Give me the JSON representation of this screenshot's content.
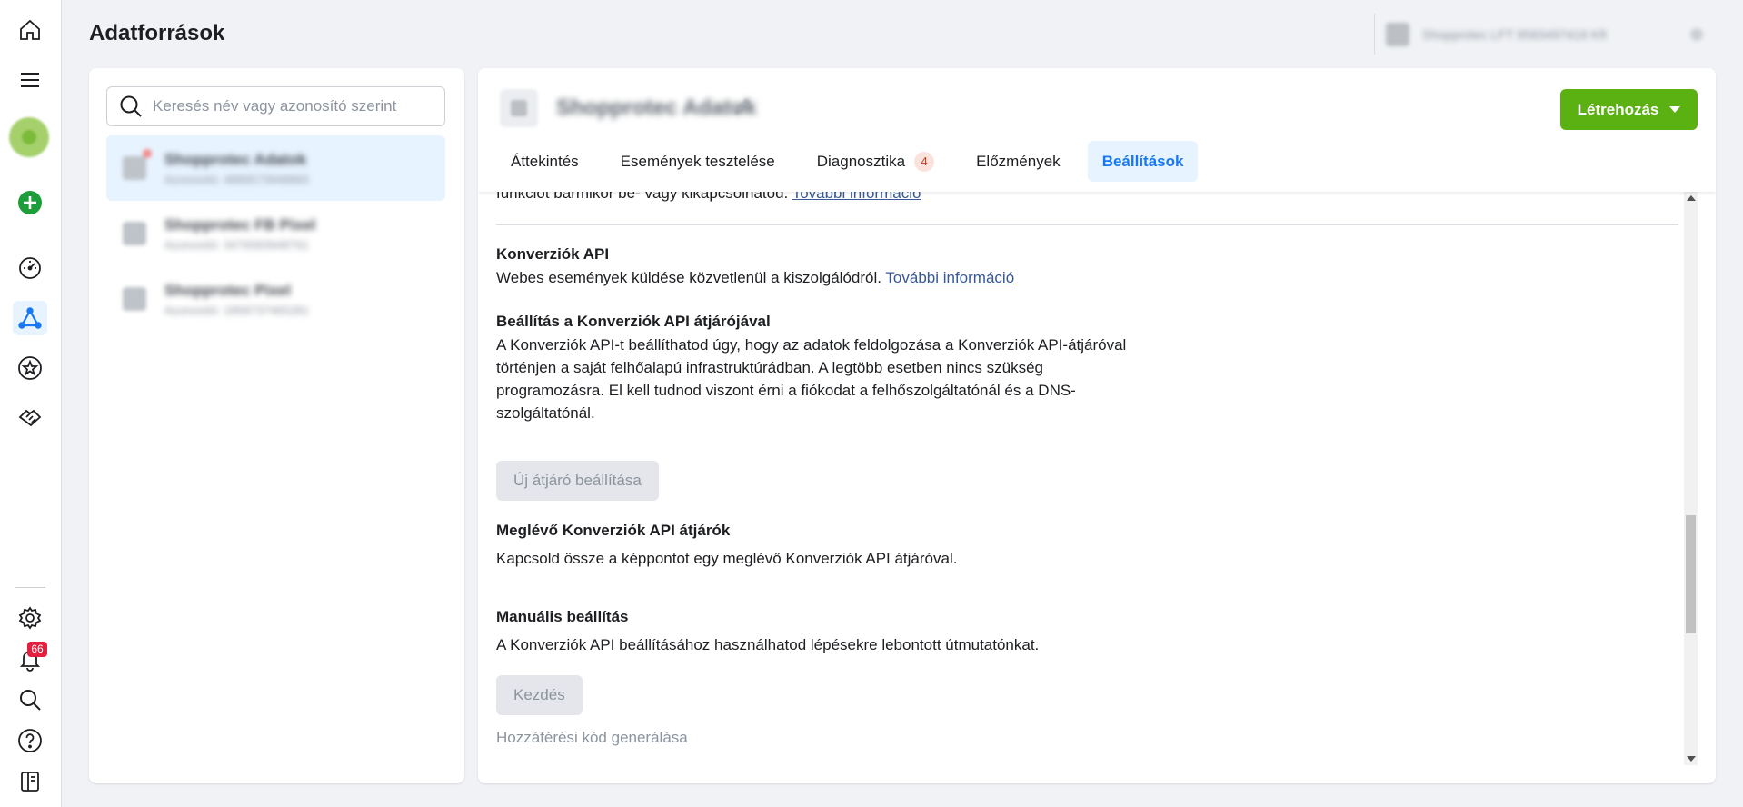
{
  "page": {
    "title": "Adatforrások"
  },
  "account": {
    "name": "Shopprotec LFT 9583497416 Kft"
  },
  "rail": {
    "notifications_count": "66"
  },
  "search": {
    "placeholder": "Keresés név vagy azonosító szerint"
  },
  "datasources": [
    {
      "name": "Shopprotec Adatok",
      "sub": "Azonosító: 4889573948865"
    },
    {
      "name": "Shopprotec FB Pixel",
      "sub": "Azonosító: 3476583948761"
    },
    {
      "name": "Shopprotec Pixel",
      "sub": "Azonosító: 1858737465281"
    }
  ],
  "main": {
    "pixel_name": "Shopprotec Adatok",
    "create_label": "Létrehozás",
    "tabs": [
      {
        "label": "Áttekintés"
      },
      {
        "label": "Események tesztelése"
      },
      {
        "label": "Diagnosztika",
        "badge": "4"
      },
      {
        "label": "Előzmények"
      },
      {
        "label": "Beállítások"
      }
    ]
  },
  "content": {
    "cut_text": "funkciót bármikor be- vagy kikapcsolhatod.",
    "cut_link": "További információ",
    "capi": {
      "title": "Konverziók API",
      "desc": "Webes események küldése közvetlenül a kiszolgálódról.",
      "link": "További információ"
    },
    "gateway": {
      "title": "Beállítás a Konverziók API átjárójával",
      "desc_lines": [
        "A Konverziók API-t beállíthatod úgy, hogy az adatok feldolgozása a Konverziók API-átjáróval",
        "történjen a saját felhőalapú infrastruktúrádban. A legtöbb esetben nincs szükség",
        "programozásra. El kell tudnod viszont érni a fiókodat a felhőszolgáltatónál és a DNS-",
        "szolgáltatónál."
      ],
      "button": "Új átjáró beállítása"
    },
    "existing": {
      "title": "Meglévő Konverziók API átjárók",
      "desc": "Kapcsold össze a képpontot egy meglévő Konverziók API átjáróval."
    },
    "manual": {
      "title": "Manuális beállítás",
      "desc": "A Konverziók API beállításához használhatod lépésekre lebontott útmutatónkat.",
      "button": "Kezdés",
      "token_link": "Hozzáférési kód generálása"
    }
  },
  "colors": {
    "accent": "#1877f2",
    "create_button": "#5bb012",
    "notification_badge": "#e41e3f"
  },
  "icons": {
    "rail": [
      "home-icon",
      "menu-icon",
      "avatar",
      "add-icon",
      "dashboard-icon",
      "events-manager-icon",
      "star-icon",
      "partners-icon",
      "settings-icon",
      "bell-icon",
      "search-icon",
      "help-icon",
      "panel-icon"
    ]
  }
}
